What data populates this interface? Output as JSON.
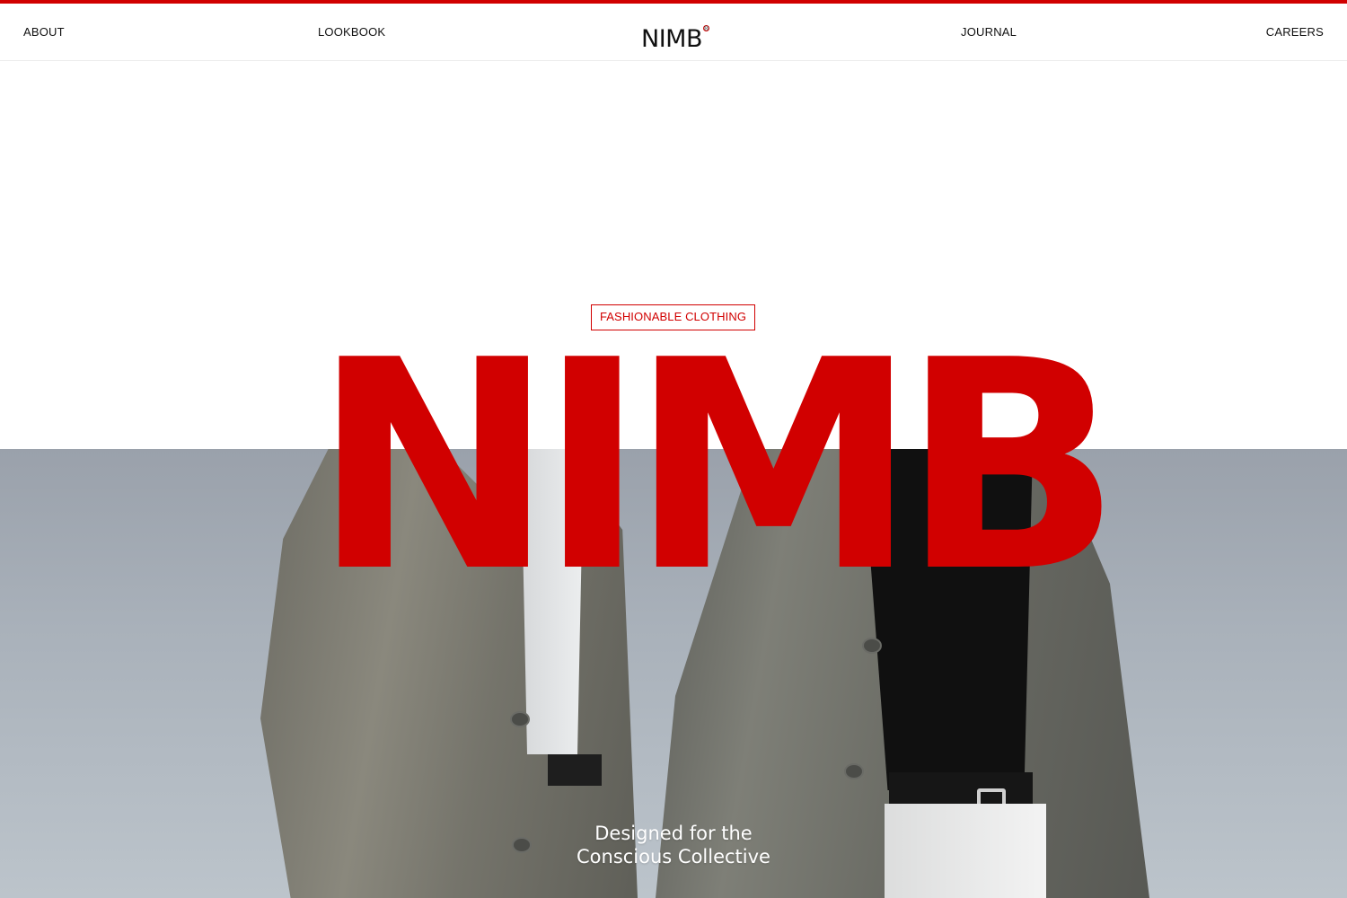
{
  "nav": {
    "about": "ABOUT",
    "lookbook": "LOOKBOOK",
    "logo": "NIMB",
    "logo_mark": "®",
    "journal": "JOURNAL",
    "careers": "CAREERS"
  },
  "hero": {
    "badge": "FASHIONABLE CLOTHING",
    "title": "NIMB",
    "tagline_line1": "Designed for the",
    "tagline_line2": "Conscious Collective"
  },
  "colors": {
    "accent": "#d10000",
    "background": "#ffffff",
    "text": "#111111"
  },
  "icons": {
    "logo_mark": "registered-trademark-icon"
  }
}
